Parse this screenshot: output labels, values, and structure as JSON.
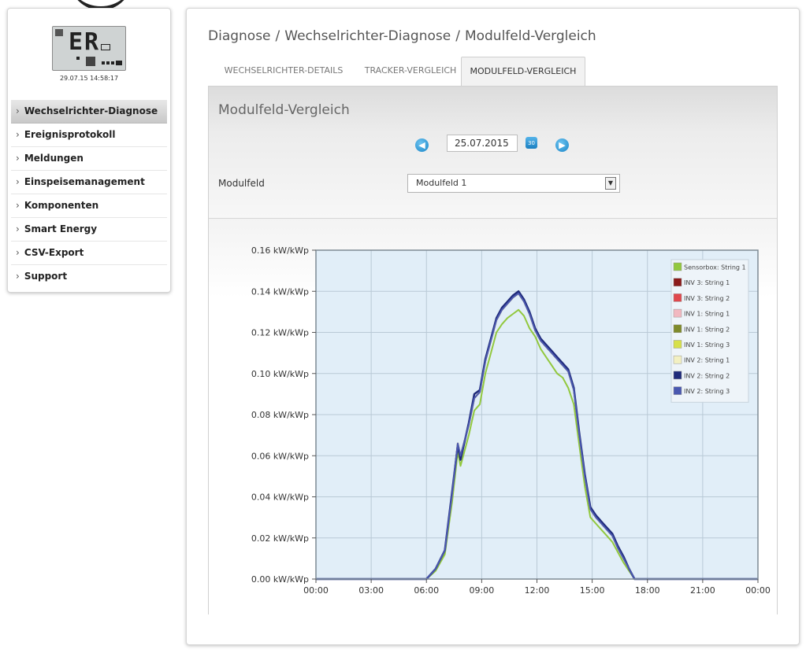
{
  "device": {
    "display_text": "ER",
    "timestamp": "29.07.15 14:58:17"
  },
  "sidebar": {
    "items": [
      {
        "label": "Wechselrichter-Diagnose",
        "active": true
      },
      {
        "label": "Ereignisprotokoll",
        "active": false
      },
      {
        "label": "Meldungen",
        "active": false
      },
      {
        "label": "Einspeisemanagement",
        "active": false
      },
      {
        "label": "Komponenten",
        "active": false
      },
      {
        "label": "Smart Energy",
        "active": false
      },
      {
        "label": "CSV-Export",
        "active": false
      },
      {
        "label": "Support",
        "active": false
      }
    ]
  },
  "breadcrumb": {
    "part1": "Diagnose",
    "part2": "Wechselrichter-Diagnose",
    "part3": "Modulfeld-Vergleich",
    "separator": "/"
  },
  "tabs": [
    {
      "label": "WECHSELRICHTER-DETAILS",
      "active": false
    },
    {
      "label": "TRACKER-VERGLEICH",
      "active": false
    },
    {
      "label": "MODULFELD-VERGLEICH",
      "active": true
    }
  ],
  "panel": {
    "title": "Modulfeld-Vergleich",
    "date": "25.07.2015",
    "calendar_icon_text": "30",
    "modulfeld_label": "Modulfeld",
    "modulfeld_value": "Modulfeld 1"
  },
  "icons": {
    "prev": "chevron-left-icon",
    "next": "chevron-right-icon",
    "calendar": "calendar-icon",
    "dropdown": "dropdown-arrow-icon"
  },
  "chart_data": {
    "type": "line",
    "title": "",
    "xlabel": "",
    "ylabel": "",
    "x_ticks": [
      "00:00",
      "03:00",
      "06:00",
      "09:00",
      "12:00",
      "15:00",
      "18:00",
      "21:00",
      "00:00"
    ],
    "y_ticks": [
      "0.00 kW/kWp",
      "0.02 kW/kWp",
      "0.04 kW/kWp",
      "0.06 kW/kWp",
      "0.08 kW/kWp",
      "0.10 kW/kWp",
      "0.12 kW/kWp",
      "0.14 kW/kWp",
      "0.16 kW/kWp"
    ],
    "xlim": [
      0,
      24
    ],
    "ylim": [
      0,
      0.16
    ],
    "grid": true,
    "legend_position": "top-right",
    "plot_background": "#e1eef8",
    "x": [
      0,
      6,
      6.5,
      7,
      7.4,
      7.7,
      7.85,
      8,
      8.3,
      8.6,
      8.9,
      9.2,
      9.5,
      9.8,
      10.1,
      10.4,
      10.7,
      11,
      11.3,
      11.6,
      11.9,
      12.2,
      12.5,
      12.8,
      13.1,
      13.4,
      13.7,
      14,
      14.3,
      14.6,
      14.9,
      15.2,
      15.5,
      15.8,
      16.1,
      16.4,
      16.7,
      17,
      17.3,
      17.6,
      17.9,
      18.1,
      24
    ],
    "series": [
      {
        "name": "Sensorbox: String 1",
        "color": "#92c83e",
        "values": [
          0,
          0,
          0.004,
          0.012,
          0.038,
          0.062,
          0.055,
          0.06,
          0.07,
          0.082,
          0.085,
          0.1,
          0.11,
          0.12,
          0.124,
          0.127,
          0.129,
          0.131,
          0.128,
          0.122,
          0.118,
          0.112,
          0.108,
          0.104,
          0.1,
          0.098,
          0.093,
          0.085,
          0.065,
          0.045,
          0.03,
          0.027,
          0.024,
          0.021,
          0.018,
          0.013,
          0.008,
          0.004,
          0,
          0,
          0,
          0,
          0
        ]
      },
      {
        "name": "INV 3: String 1",
        "color": "#8b1a1a",
        "values": [
          0,
          0,
          0.005,
          0.014,
          0.042,
          0.066,
          0.06,
          0.065,
          0.075,
          0.088,
          0.091,
          0.106,
          0.116,
          0.126,
          0.131,
          0.134,
          0.137,
          0.139,
          0.135,
          0.129,
          0.121,
          0.116,
          0.113,
          0.11,
          0.107,
          0.104,
          0.101,
          0.092,
          0.07,
          0.05,
          0.034,
          0.03,
          0.027,
          0.024,
          0.021,
          0.015,
          0.01,
          0.005,
          0,
          0,
          0,
          0,
          0
        ]
      },
      {
        "name": "INV 3: String 2",
        "color": "#e0474c",
        "values": [
          0,
          0,
          0.005,
          0.014,
          0.042,
          0.066,
          0.06,
          0.065,
          0.075,
          0.088,
          0.091,
          0.106,
          0.116,
          0.126,
          0.131,
          0.134,
          0.137,
          0.139,
          0.135,
          0.129,
          0.121,
          0.116,
          0.113,
          0.11,
          0.107,
          0.104,
          0.101,
          0.092,
          0.07,
          0.05,
          0.034,
          0.03,
          0.027,
          0.024,
          0.021,
          0.015,
          0.01,
          0.005,
          0,
          0,
          0,
          0,
          0
        ]
      },
      {
        "name": "INV 1: String 1",
        "color": "#f2b8c0",
        "values": [
          0,
          0,
          0.005,
          0.014,
          0.042,
          0.066,
          0.06,
          0.065,
          0.075,
          0.088,
          0.091,
          0.106,
          0.116,
          0.126,
          0.131,
          0.134,
          0.137,
          0.139,
          0.135,
          0.129,
          0.121,
          0.116,
          0.113,
          0.11,
          0.107,
          0.104,
          0.101,
          0.092,
          0.07,
          0.05,
          0.034,
          0.03,
          0.027,
          0.024,
          0.021,
          0.015,
          0.01,
          0.005,
          0,
          0,
          0,
          0,
          0
        ]
      },
      {
        "name": "INV 1: String 2",
        "color": "#7f8a2a",
        "values": [
          0,
          0,
          0.005,
          0.014,
          0.042,
          0.066,
          0.06,
          0.065,
          0.075,
          0.088,
          0.091,
          0.106,
          0.116,
          0.126,
          0.131,
          0.134,
          0.137,
          0.139,
          0.135,
          0.129,
          0.121,
          0.116,
          0.113,
          0.11,
          0.107,
          0.104,
          0.101,
          0.092,
          0.07,
          0.05,
          0.034,
          0.03,
          0.027,
          0.024,
          0.021,
          0.015,
          0.01,
          0.005,
          0,
          0,
          0,
          0,
          0
        ]
      },
      {
        "name": "INV 1: String 3",
        "color": "#d7e04a",
        "values": [
          0,
          0,
          0.005,
          0.014,
          0.042,
          0.066,
          0.06,
          0.065,
          0.075,
          0.088,
          0.091,
          0.106,
          0.116,
          0.126,
          0.131,
          0.134,
          0.137,
          0.139,
          0.135,
          0.129,
          0.121,
          0.116,
          0.113,
          0.11,
          0.107,
          0.104,
          0.101,
          0.092,
          0.07,
          0.05,
          0.034,
          0.03,
          0.027,
          0.024,
          0.021,
          0.015,
          0.01,
          0.005,
          0,
          0,
          0,
          0,
          0
        ]
      },
      {
        "name": "INV 2: String 1",
        "color": "#f3f0c2",
        "values": [
          0,
          0,
          0.005,
          0.014,
          0.042,
          0.066,
          0.06,
          0.065,
          0.075,
          0.088,
          0.091,
          0.106,
          0.116,
          0.126,
          0.131,
          0.134,
          0.137,
          0.139,
          0.135,
          0.129,
          0.121,
          0.116,
          0.113,
          0.11,
          0.107,
          0.104,
          0.101,
          0.092,
          0.07,
          0.05,
          0.034,
          0.03,
          0.027,
          0.024,
          0.021,
          0.015,
          0.01,
          0.005,
          0,
          0,
          0,
          0,
          0
        ]
      },
      {
        "name": "INV 2: String 2",
        "color": "#1f2a7a",
        "values": [
          0,
          0,
          0.005,
          0.014,
          0.043,
          0.065,
          0.058,
          0.064,
          0.076,
          0.09,
          0.092,
          0.107,
          0.117,
          0.127,
          0.132,
          0.135,
          0.138,
          0.14,
          0.136,
          0.13,
          0.122,
          0.117,
          0.114,
          0.111,
          0.108,
          0.105,
          0.102,
          0.093,
          0.071,
          0.051,
          0.035,
          0.031,
          0.028,
          0.025,
          0.022,
          0.016,
          0.011,
          0.005,
          0,
          0,
          0,
          0,
          0
        ]
      },
      {
        "name": "INV 2: String 3",
        "color": "#4a58b0",
        "values": [
          0,
          0,
          0.005,
          0.014,
          0.042,
          0.066,
          0.06,
          0.065,
          0.075,
          0.088,
          0.091,
          0.106,
          0.116,
          0.126,
          0.131,
          0.134,
          0.137,
          0.139,
          0.135,
          0.129,
          0.121,
          0.116,
          0.113,
          0.11,
          0.107,
          0.104,
          0.101,
          0.092,
          0.07,
          0.05,
          0.034,
          0.03,
          0.027,
          0.024,
          0.021,
          0.015,
          0.01,
          0.005,
          0,
          0,
          0,
          0,
          0
        ]
      }
    ]
  }
}
